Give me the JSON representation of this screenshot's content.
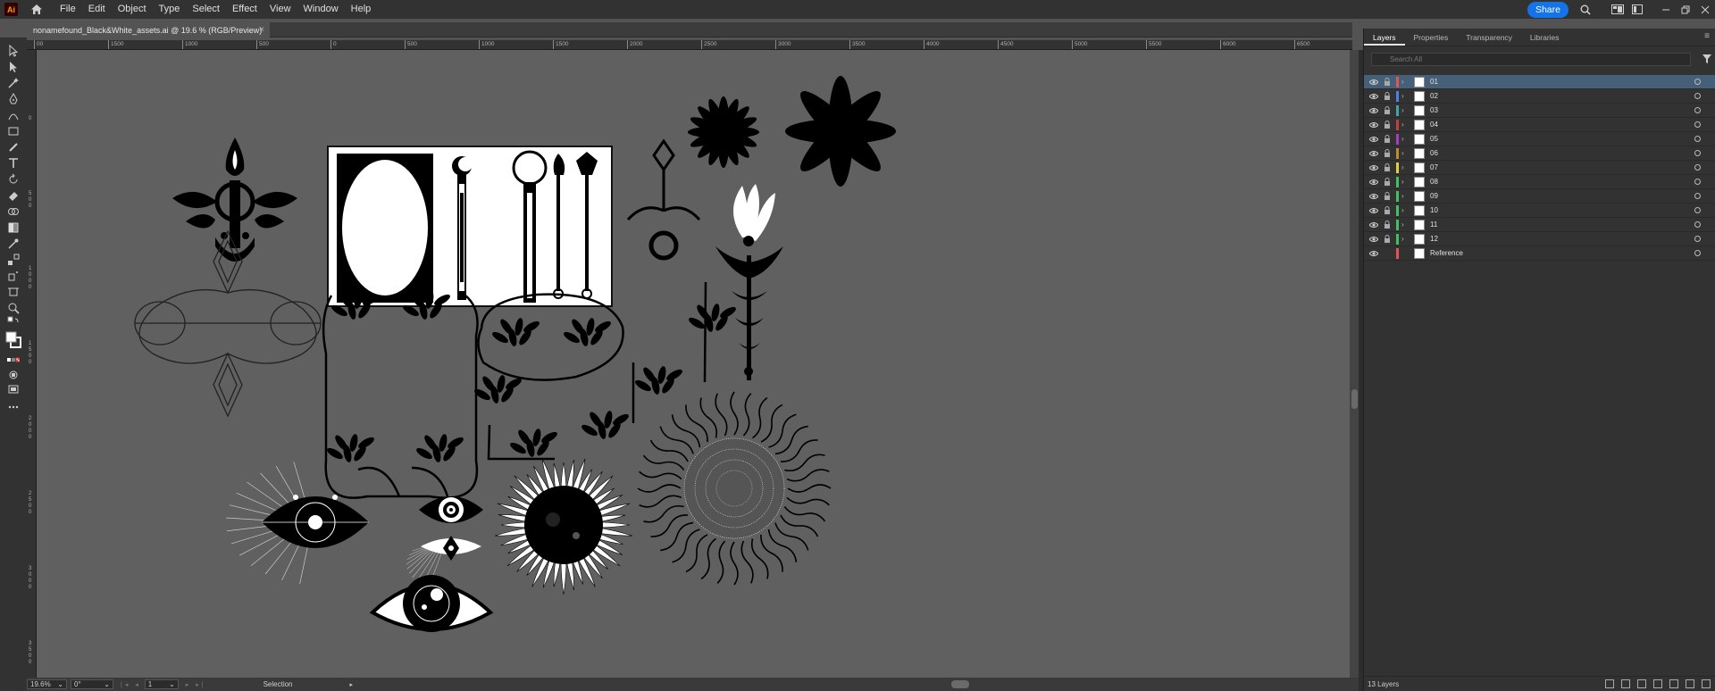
{
  "app": {
    "logo": "Ai"
  },
  "menu": [
    "File",
    "Edit",
    "Object",
    "Type",
    "Select",
    "Effect",
    "View",
    "Window",
    "Help"
  ],
  "share_label": "Share",
  "document": {
    "tab_title": "nonamefound_Black&White_assets.ai @ 19.6 % (RGB/Preview)",
    "close": "×"
  },
  "ruler": {
    "h_labels": [
      "00",
      "1500",
      "1000",
      "500",
      "0",
      "500",
      "1000",
      "1500",
      "2000",
      "2500",
      "3000",
      "3500",
      "4000",
      "4500",
      "5000",
      "5500",
      "6000",
      "6500"
    ],
    "v_labels": [
      "0",
      "5 0 0",
      "1 0 0 0",
      "1 5 0 0",
      "2 0 0 0",
      "2 5 0 0",
      "3 0 0 0",
      "3 5 0 0"
    ]
  },
  "panel": {
    "tabs": [
      "Layers",
      "Properties",
      "Transparency",
      "Libraries"
    ],
    "search_placeholder": "Search All",
    "layers": [
      {
        "name": "01",
        "color": "#e05555",
        "selected": true
      },
      {
        "name": "02",
        "color": "#4f7fe0"
      },
      {
        "name": "03",
        "color": "#3fa5a5"
      },
      {
        "name": "04",
        "color": "#c04040"
      },
      {
        "name": "05",
        "color": "#a040c0"
      },
      {
        "name": "06",
        "color": "#c08a30"
      },
      {
        "name": "07",
        "color": "#e0d040"
      },
      {
        "name": "08",
        "color": "#40c060"
      },
      {
        "name": "09",
        "color": "#40c060"
      },
      {
        "name": "10",
        "color": "#40c060"
      },
      {
        "name": "11",
        "color": "#40c060"
      },
      {
        "name": "12",
        "color": "#40c060"
      },
      {
        "name": "Reference",
        "color": "#e05555",
        "no_lock": true
      }
    ],
    "layer_count": "13 Layers"
  },
  "status": {
    "zoom": "19.6%",
    "rotation": "0°",
    "artboard": "1",
    "tool": "Selection"
  }
}
